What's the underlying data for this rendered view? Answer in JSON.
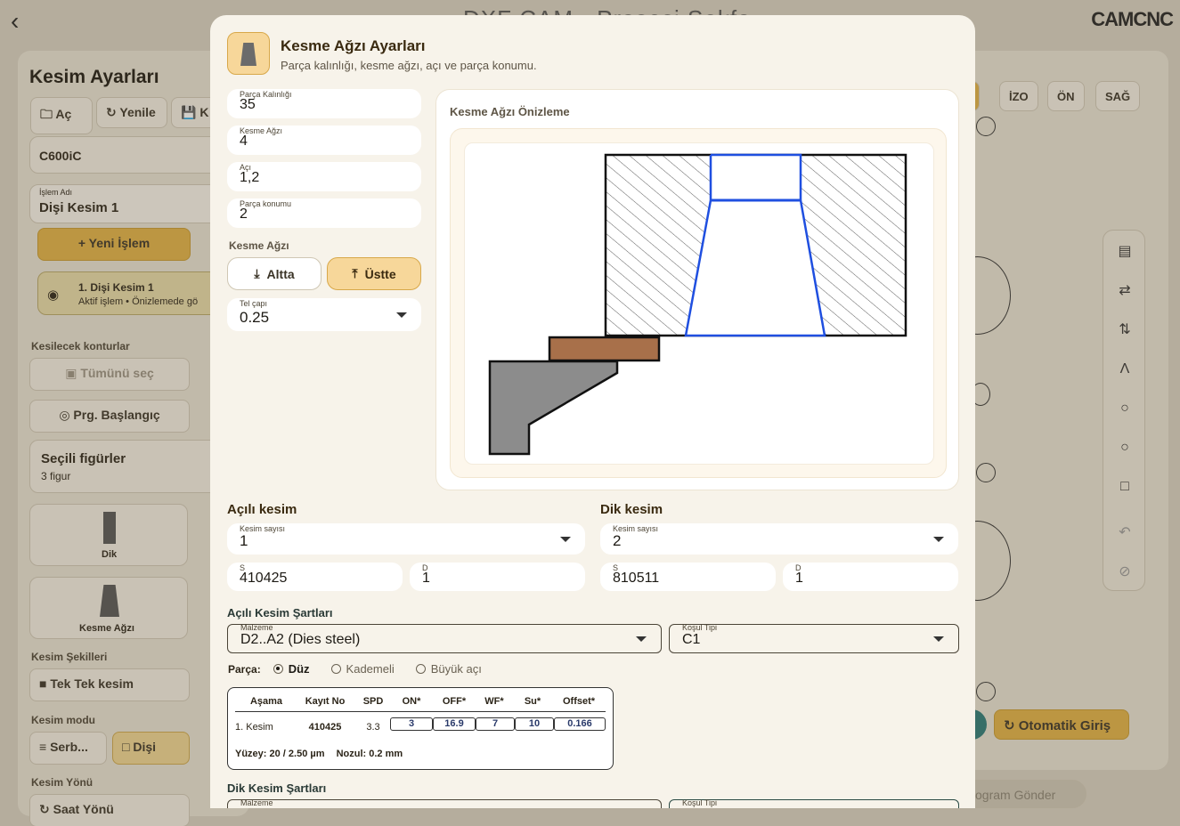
{
  "background": {
    "app_title": "DXF CAM - Prosesi Sekfo",
    "logo": "CAMCNC",
    "left_panel": {
      "title": "Kesim Ayarları",
      "toolbar": [
        "Aç",
        "Yenile",
        "K"
      ],
      "machine": "C600iC",
      "op_name_label": "İşlem Adı",
      "op_name": "Dişi Kesim 1",
      "new_op": "Yeni İşlem",
      "active_op_title": "1. Dişi Kesim 1",
      "active_op_sub": "Aktif işlem • Önizlemede gö",
      "contours_label": "Kesilecek konturlar",
      "select_all": "Tümünü seç",
      "prg_start": "Prg. Başlangıç",
      "selected_figs_title": "Seçili figürler",
      "selected_figs_count": "3 figur",
      "shape_dik": "Dik",
      "shape_kesme": "Kesme Ağzı",
      "shapes_label": "Kesim Şekilleri",
      "single_cut": "Tek Tek kesim",
      "mode_label": "Kesim modu",
      "mode_free": "Serb...",
      "mode_female": "Dişi",
      "dir_label": "Kesim Yönü",
      "dir_value": "Saat Yönü"
    },
    "right_panel": {
      "tabs": [
        "T",
        "İZO",
        "ÖN",
        "SAĞ"
      ],
      "auto_entry": "Otomatik Giriş",
      "send_program": "Program Gönder"
    }
  },
  "modal": {
    "title": "Kesme Ağzı Ayarları",
    "subtitle": "Parça kalınlığı, kesme ağzı, açı ve parça konumu.",
    "fields": {
      "thickness": {
        "label": "Parça Kalınlığı",
        "value": "35"
      },
      "kerf": {
        "label": "Kesme Ağzı",
        "value": "4"
      },
      "angle": {
        "label": "Açı",
        "value": "1,2"
      },
      "position": {
        "label": "Parça konumu",
        "value": "2"
      }
    },
    "kerf_side_label": "Kesme Ağzı",
    "kerf_side_options": [
      "Altta",
      "Üstte"
    ],
    "kerf_side_selected": "Üstte",
    "wire": {
      "label": "Tel çapı",
      "value": "0.25"
    },
    "preview_title": "Kesme Ağzı Önizleme",
    "angled_cut": {
      "title": "Açılı kesim",
      "count_label": "Kesim sayısı",
      "count": "1",
      "s_label": "S",
      "s": "410425",
      "d_label": "D",
      "d": "1"
    },
    "straight_cut": {
      "title": "Dik kesim",
      "count_label": "Kesim sayısı",
      "count": "2",
      "s_label": "S",
      "s": "810511",
      "d_label": "D",
      "d": "1"
    },
    "angled_conditions": {
      "title": "Açılı Kesim Şartları",
      "material_label": "Malzeme",
      "material": "D2..A2 (Dies steel)",
      "cond_label": "Koşul Tipi",
      "cond": "C1",
      "part_label": "Parça:",
      "part_options": [
        "Düz",
        "Kademeli",
        "Büyük açı"
      ],
      "part_selected": "Düz",
      "table": {
        "headers": [
          "Aşama",
          "Kayıt No",
          "SPD",
          "ON*",
          "OFF*",
          "WF*",
          "Su*",
          "Offset*"
        ],
        "rows": [
          {
            "stage": "1. Kesim",
            "record": "410425",
            "spd": "3.3",
            "on": "3",
            "off": "16.9",
            "wf": "7",
            "su": "10",
            "offset": "0.166"
          }
        ],
        "surface": "Yüzey: 20 / 2.50 µm",
        "nozzle": "Nozul: 0.2 mm"
      }
    },
    "straight_conditions": {
      "title": "Dik Kesim Şartları",
      "material_label": "Malzeme",
      "cond_label": "Koşul Tipi"
    },
    "colors": {
      "accent": "#f7d79a",
      "accent_border": "#d8a84a",
      "profile_blue": "#1f4fe0",
      "wire_brown": "#a8704a",
      "holder_gray": "#8c8c8c"
    }
  }
}
